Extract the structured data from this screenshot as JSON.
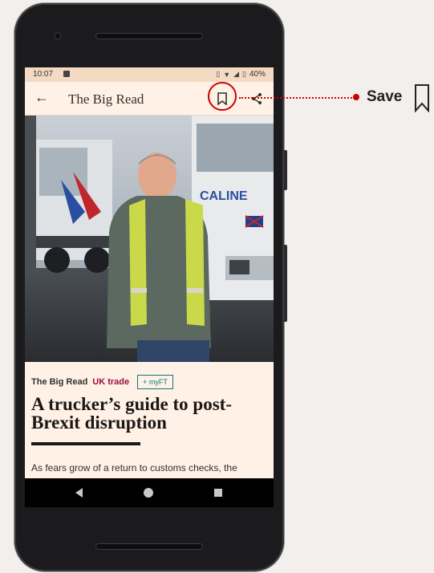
{
  "status_bar": {
    "time": "10:07",
    "battery": "40%"
  },
  "app_bar": {
    "title": "The Big Read"
  },
  "article": {
    "section": "The Big Read",
    "topic": "UK trade",
    "myft_label": "+ myFT",
    "headline": "A trucker’s guide to post-Brexit disruption",
    "standfirst": "As fears grow of a return to customs checks, the"
  },
  "annotation": {
    "label": "Save"
  },
  "icons": {
    "back": "arrow-left-icon",
    "bookmark": "bookmark-icon",
    "share": "share-icon",
    "nav_back": "triangle-back-icon",
    "nav_home": "circle-home-icon",
    "nav_recent": "square-recent-icon"
  },
  "colors": {
    "background": "#fff1e5",
    "topic": "#990f3d",
    "myft": "#0d7680",
    "annotation": "#cc0000"
  }
}
